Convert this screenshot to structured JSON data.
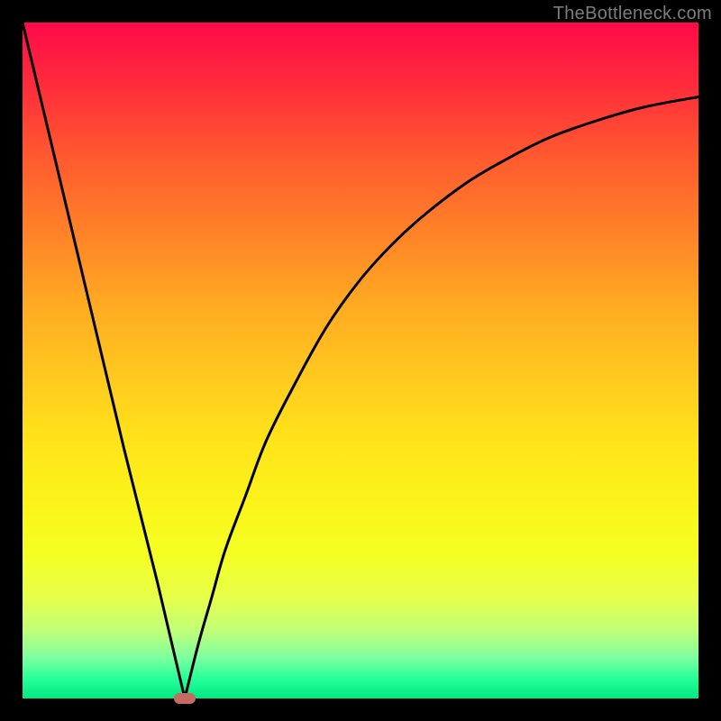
{
  "watermark": "TheBottleneck.com",
  "colors": {
    "frame": "#000000",
    "curve": "#000000",
    "marker": "#c76a60"
  },
  "chart_data": {
    "type": "line",
    "title": "",
    "xlabel": "",
    "ylabel": "",
    "xlim": [
      0,
      100
    ],
    "ylim": [
      0,
      100
    ],
    "grid": false,
    "series": [
      {
        "name": "left-branch",
        "x": [
          0,
          5,
          10,
          15,
          20,
          24
        ],
        "values": [
          100,
          79,
          58,
          37,
          17,
          0
        ]
      },
      {
        "name": "right-branch",
        "x": [
          24,
          26,
          28,
          30,
          33,
          36,
          40,
          45,
          50,
          55,
          60,
          66,
          72,
          78,
          85,
          92,
          100
        ],
        "values": [
          0,
          8,
          15,
          22,
          30,
          38,
          46,
          55,
          62,
          67.5,
          72,
          76.5,
          80,
          83,
          85.5,
          87.5,
          89
        ]
      }
    ],
    "annotations": [
      {
        "name": "min-marker",
        "x": 24,
        "y": 0
      }
    ]
  }
}
